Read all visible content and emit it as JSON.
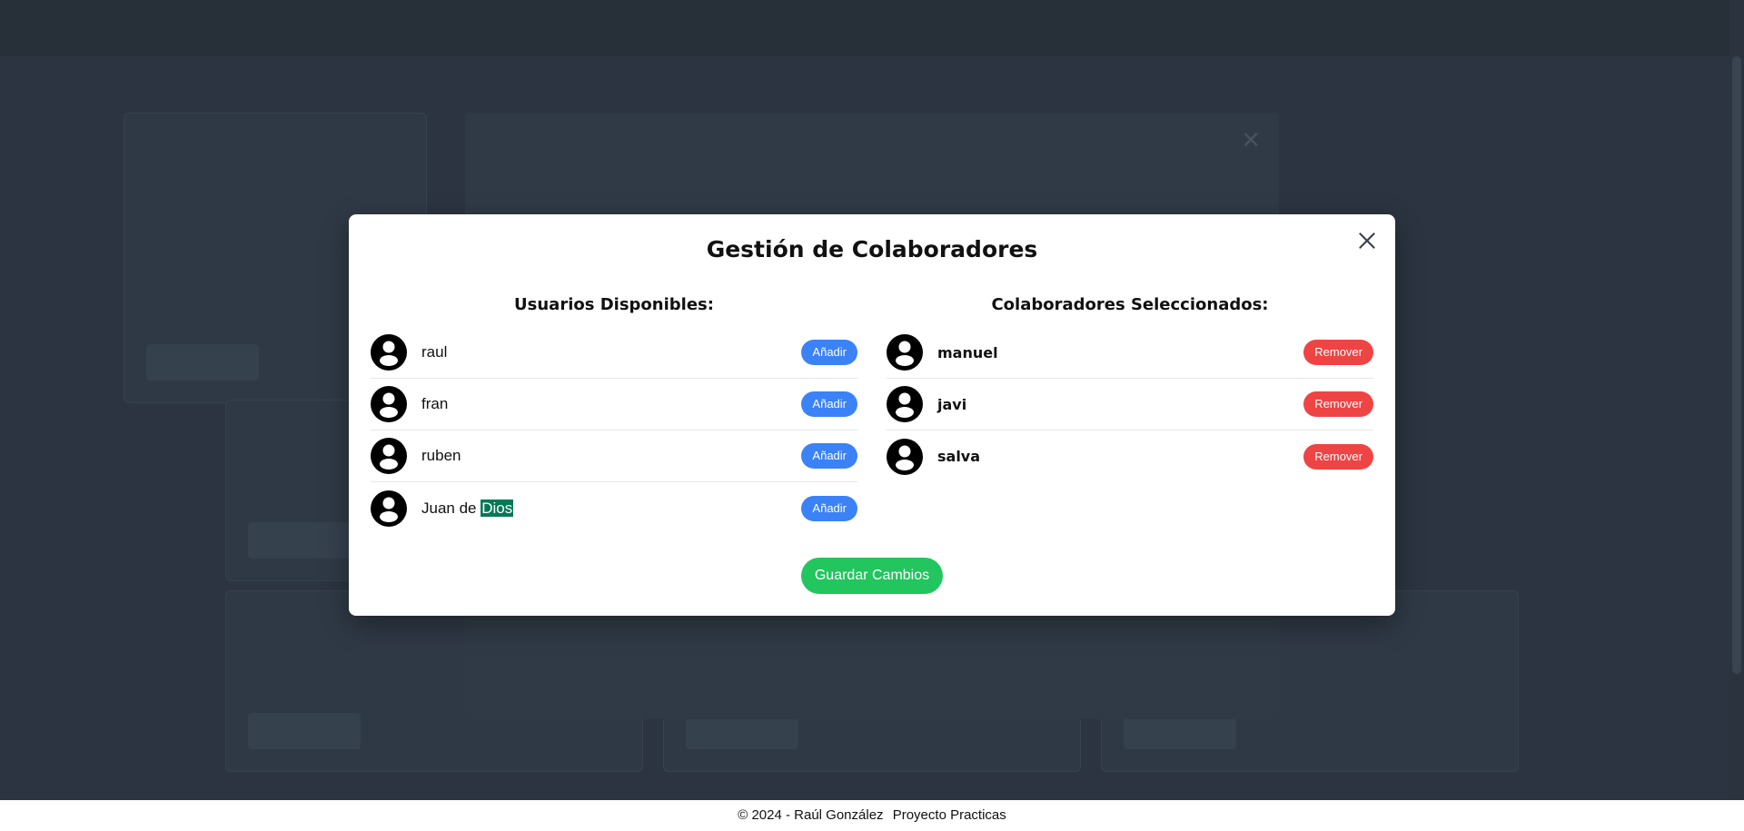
{
  "modal": {
    "title": "Gestión de Colaboradores",
    "available_title": "Usuarios Disponibles:",
    "selected_title": "Colaboradores Seleccionados:",
    "add_label": "Añadir",
    "remove_label": "Remover",
    "save_label": "Guardar Cambios",
    "available_users": [
      {
        "name": "raul"
      },
      {
        "name": "fran"
      },
      {
        "name": "ruben"
      },
      {
        "name_prefix": "Juan de ",
        "name_highlight": "Dios"
      }
    ],
    "selected_users": [
      {
        "name": "manuel"
      },
      {
        "name": "javi"
      },
      {
        "name": "salva"
      }
    ]
  },
  "footer": {
    "copyright": "© 2024 - Raúl González",
    "project": "Proyecto Practicas"
  },
  "colors": {
    "add": "#3b82f6",
    "remove": "#ef4444",
    "save": "#22c55e",
    "highlight": "#047857"
  },
  "icons": {
    "avatar": "user-circle-icon",
    "close": "close-icon"
  }
}
